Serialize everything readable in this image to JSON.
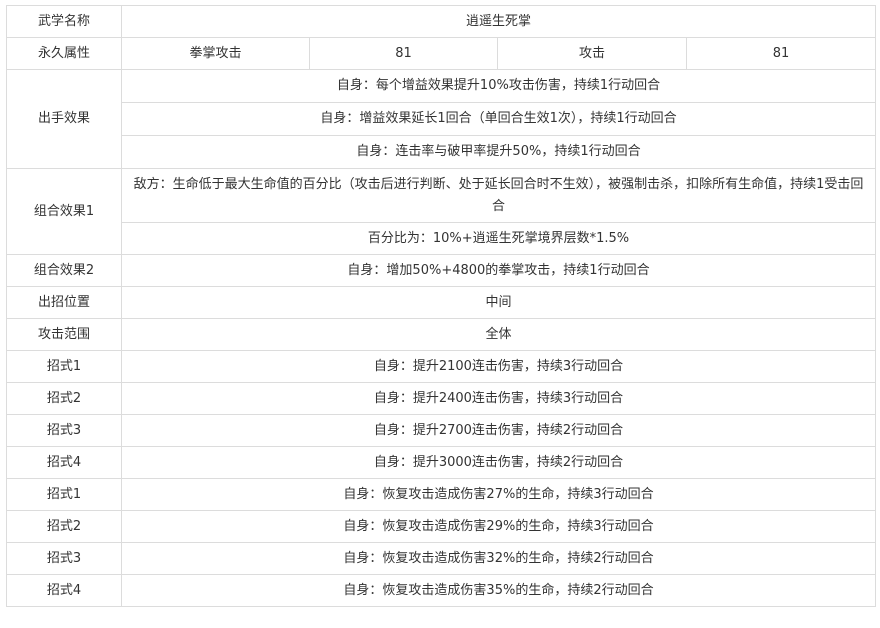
{
  "header": {
    "label": "武学名称",
    "value": "逍遥生死掌"
  },
  "permanent": {
    "label": "永久属性",
    "attr1_name": "拳掌攻击",
    "attr1_value": "81",
    "attr2_name": "攻击",
    "attr2_value": "81"
  },
  "attack_effect": {
    "label": "出手效果",
    "lines": [
      "自身：每个增益效果提升10%攻击伤害，持续1行动回合",
      "自身：增益效果延长1回合（单回合生效1次），持续1行动回合",
      "自身：连击率与破甲率提升50%，持续1行动回合"
    ]
  },
  "combo1": {
    "label": "组合效果1",
    "lines": [
      "敌方：生命低于最大生命值的百分比（攻击后进行判断、处于延长回合时不生效），被强制击杀，扣除所有生命值，持续1受击回合",
      "百分比为：10%+逍遥生死掌境界层数*1.5%"
    ]
  },
  "combo2": {
    "label": "组合效果2",
    "value": "自身：增加50%+4800的拳掌攻击，持续1行动回合"
  },
  "position": {
    "label": "出招位置",
    "value": "中间"
  },
  "range": {
    "label": "攻击范围",
    "value": "全体"
  },
  "moves": [
    {
      "label": "招式1",
      "value": "自身：提升2100连击伤害，持续3行动回合"
    },
    {
      "label": "招式2",
      "value": "自身：提升2400连击伤害，持续3行动回合"
    },
    {
      "label": "招式3",
      "value": "自身：提升2700连击伤害，持续2行动回合"
    },
    {
      "label": "招式4",
      "value": "自身：提升3000连击伤害，持续2行动回合"
    },
    {
      "label": "招式1",
      "value": "自身：恢复攻击造成伤害27%的生命，持续3行动回合"
    },
    {
      "label": "招式2",
      "value": "自身：恢复攻击造成伤害29%的生命，持续3行动回合"
    },
    {
      "label": "招式3",
      "value": "自身：恢复攻击造成伤害32%的生命，持续2行动回合"
    },
    {
      "label": "招式4",
      "value": "自身：恢复攻击造成伤害35%的生命，持续2行动回合"
    }
  ]
}
